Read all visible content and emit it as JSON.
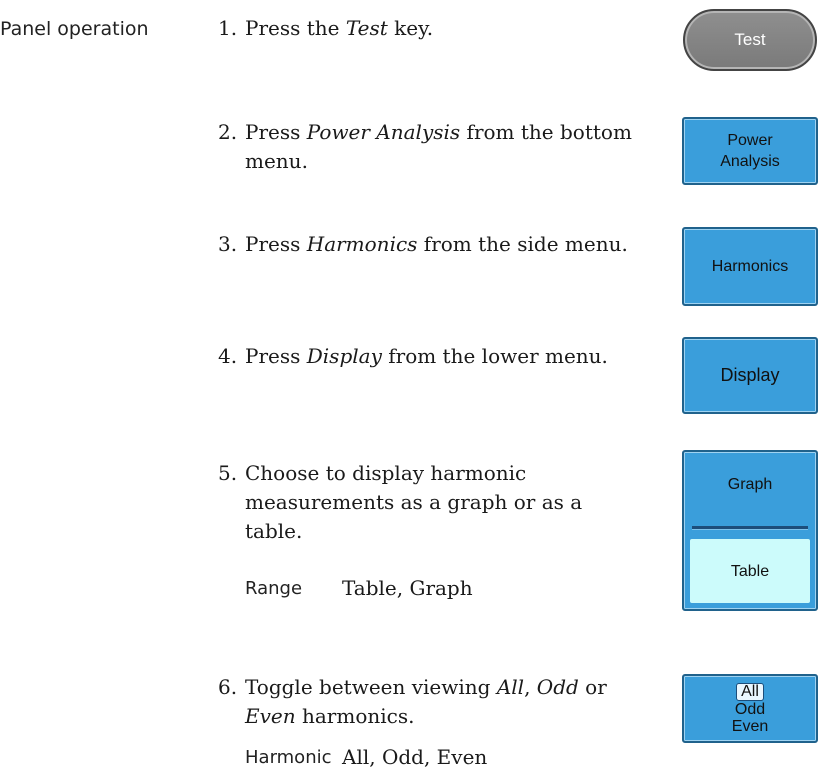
{
  "side_label": "Panel operation",
  "steps": [
    {
      "num": "1.",
      "parts": [
        "Press the ",
        "Test",
        " key."
      ]
    },
    {
      "num": "2.",
      "parts": [
        "Press ",
        "Power Analysis",
        " from the bottom menu."
      ]
    },
    {
      "num": "3.",
      "parts": [
        "Press ",
        "Harmonics",
        " from the side menu."
      ]
    },
    {
      "num": "4.",
      "parts": [
        "Press ",
        "Display",
        " from the lower menu."
      ]
    },
    {
      "num": "5.",
      "text": "Choose to display harmonic measurements as a graph or as a table."
    },
    {
      "num": "6.",
      "parts": [
        "Toggle between viewing ",
        "All",
        ", ",
        "Odd",
        " or ",
        "Even",
        " harmonics."
      ]
    }
  ],
  "range": {
    "label": "Range",
    "value": "Table, Graph"
  },
  "harmonic": {
    "label": "Harmonic",
    "value": "All, Odd, Even"
  },
  "keys": {
    "test": "Test",
    "power_line1": "Power",
    "power_line2": "Analysis",
    "harmonics": "Harmonics",
    "display": "Display",
    "graph": "Graph",
    "table": "Table",
    "all": "All",
    "odd": "Odd",
    "even": "Even"
  },
  "colors": {
    "soft_key": "#3a9edb",
    "soft_key_border": "#20628c",
    "selected_option": "#ccfbfb",
    "test_key": "#858585"
  }
}
